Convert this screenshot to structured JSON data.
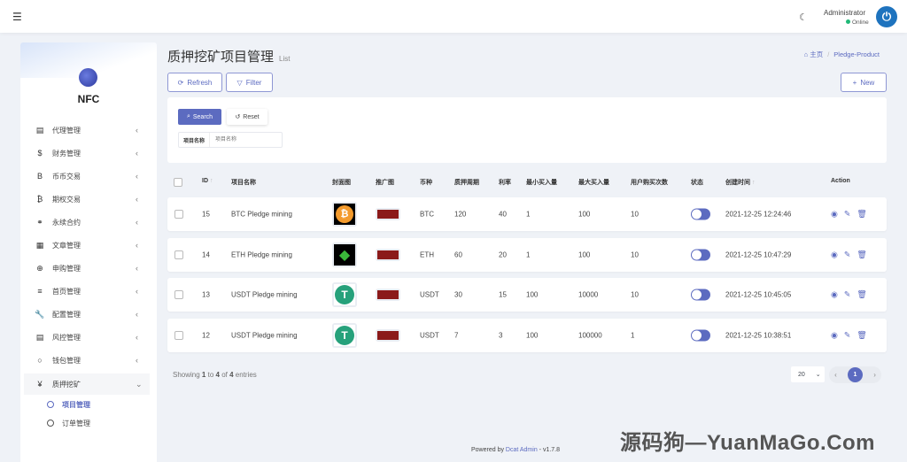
{
  "header": {
    "user_name": "Administrator",
    "status": "Online"
  },
  "sidebar": {
    "brand": "NFC",
    "items": [
      {
        "label": "代理管理",
        "icon": "id-card"
      },
      {
        "label": "财务管理",
        "icon": "$"
      },
      {
        "label": "币币交易",
        "icon": "B"
      },
      {
        "label": "期权交易",
        "icon": "₿"
      },
      {
        "label": "永续合约",
        "icon": "link"
      },
      {
        "label": "文章管理",
        "icon": "newspaper"
      },
      {
        "label": "申购管理",
        "icon": "globe"
      },
      {
        "label": "首页管理",
        "icon": "list"
      },
      {
        "label": "配置管理",
        "icon": "wrench"
      },
      {
        "label": "风控管理",
        "icon": "list-alt"
      },
      {
        "label": "钱包管理",
        "icon": "circle"
      },
      {
        "label": "质押挖矿",
        "icon": "¥"
      }
    ],
    "sub_items": [
      {
        "label": "项目管理"
      },
      {
        "label": "订单管理"
      }
    ]
  },
  "page": {
    "title": "质押挖矿项目管理",
    "subtitle": "List",
    "breadcrumb_home": "主页",
    "breadcrumb_current": "Pledge-Product"
  },
  "toolbar": {
    "refresh": "Refresh",
    "filter": "Filter",
    "new": "New"
  },
  "filter": {
    "search": "Search",
    "reset": "Reset",
    "field_label": "项目名称",
    "field_placeholder": "项目名称",
    "field_value": ""
  },
  "table": {
    "headers": [
      "ID",
      "项目名称",
      "封面图",
      "推广图",
      "币种",
      "质押周期",
      "利率",
      "最小买入量",
      "最大买入量",
      "用户购买次数",
      "状态",
      "创建时间",
      "Action"
    ],
    "rows": [
      {
        "id": "15",
        "name": "BTC Pledge mining",
        "coin": "BTC",
        "period": "120",
        "rate": "40",
        "min": "1",
        "max": "100",
        "times": "10",
        "status": true,
        "created": "2021-12-25 12:24:46"
      },
      {
        "id": "14",
        "name": "ETH Pledge mining",
        "coin": "ETH",
        "period": "60",
        "rate": "20",
        "min": "1",
        "max": "100",
        "times": "10",
        "status": true,
        "created": "2021-12-25 10:47:29"
      },
      {
        "id": "13",
        "name": "USDT Pledge mining",
        "coin": "USDT",
        "period": "30",
        "rate": "15",
        "min": "100",
        "max": "10000",
        "times": "10",
        "status": true,
        "created": "2021-12-25 10:45:05"
      },
      {
        "id": "12",
        "name": "USDT Pledge mining",
        "coin": "USDT",
        "period": "7",
        "rate": "3",
        "min": "100",
        "max": "100000",
        "times": "1",
        "status": true,
        "created": "2021-12-25 10:38:51"
      }
    ]
  },
  "pagination": {
    "showing_prefix": "Showing",
    "from": "1",
    "to_word": "to",
    "to": "4",
    "of_word": "of",
    "total": "4",
    "entries_word": "entries",
    "per_page": "20",
    "current_page": "1"
  },
  "footer": {
    "powered": "Powered by",
    "link": "Dcat Admin",
    "version": "v1.7.8"
  },
  "watermark": "源码狗—YuanMaGo.Com",
  "colors": {
    "accent": "#5c6bc0",
    "online": "#21b978"
  }
}
